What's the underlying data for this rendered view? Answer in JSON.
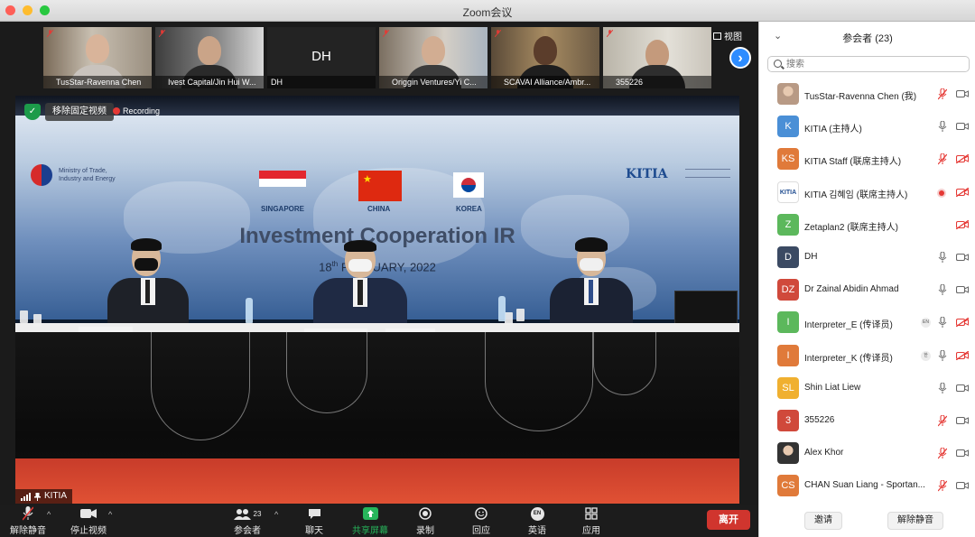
{
  "window": {
    "title": "Zoom会议"
  },
  "gallery": {
    "view_label": "视图",
    "tiles": [
      {
        "name": "TusStar-Ravenna Chen"
      },
      {
        "name": "Ivest Capital/Jin Hui W..."
      },
      {
        "name": "DH",
        "initials": "DH"
      },
      {
        "name": "Origgin Ventures/Yi C..."
      },
      {
        "name": "SCAVAI Alliance/Ambr..."
      },
      {
        "name": "355226"
      }
    ]
  },
  "main_video": {
    "unpin_label": "移除固定视频",
    "recording_label": "Recording",
    "speaker_name": "KITIA",
    "slide": {
      "ministry": "Ministry of Trade,\nIndustry and Energy",
      "flags": [
        "SINGAPORE",
        "CHINA",
        "KOREA"
      ],
      "kitia_logo": "KITIA",
      "headline": "Investment Cooperation IR",
      "date_prefix": "18",
      "date_sup": "th",
      "date_rest": " FEBRUARY, 2022"
    }
  },
  "toolbar": {
    "unmute": "解除静音",
    "stop_video": "停止视频",
    "participants": "参会者",
    "participants_count": "23",
    "chat": "聊天",
    "share": "共享屏幕",
    "record": "录制",
    "reactions": "回应",
    "language": "英语",
    "language_badge": "EN",
    "apps": "应用",
    "leave": "离开"
  },
  "panel": {
    "title": "参会者 (23)",
    "search_placeholder": "搜索",
    "invite": "邀请",
    "unmute": "解除静音",
    "participants": [
      {
        "name": "TusStar-Ravenna Chen (我)",
        "avatar": "",
        "color": "#b89a85",
        "photo": true,
        "mic": "muted",
        "cam": "on"
      },
      {
        "name": "KITIA (主持人)",
        "avatar": "K",
        "color": "#4a8fd6",
        "mic": "on",
        "cam": "on"
      },
      {
        "name": "KITIA Staff (联席主持人)",
        "avatar": "KS",
        "color": "#e07a3a",
        "mic": "muted",
        "cam": "off"
      },
      {
        "name": "KITIA 김혜임 (联席主持人)",
        "avatar": "",
        "color": "#1e4b8f",
        "logo": true,
        "mic": "recording",
        "cam": "off-muted"
      },
      {
        "name": "Zetaplan2 (联席主持人)",
        "avatar": "Z",
        "color": "#5cb85c",
        "mic": "none",
        "cam": "off"
      },
      {
        "name": "DH",
        "avatar": "D",
        "color": "#3b4a63",
        "mic": "on",
        "cam": "on"
      },
      {
        "name": "Dr Zainal Abidin Ahmad",
        "avatar": "DZ",
        "color": "#d0493b",
        "mic": "on",
        "cam": "on"
      },
      {
        "name": "Interpreter_E (传译员)",
        "avatar": "I",
        "color": "#5cb85c",
        "badge": "EN",
        "mic": "on",
        "cam": "off"
      },
      {
        "name": "Interpreter_K (传译员)",
        "avatar": "I",
        "color": "#e07a3a",
        "badge": "한",
        "mic": "on",
        "cam": "off"
      },
      {
        "name": "Shin Liat Liew",
        "avatar": "SL",
        "color": "#f0b030",
        "mic": "on",
        "cam": "on"
      },
      {
        "name": "355226",
        "avatar": "3",
        "color": "#d0493b",
        "mic": "muted",
        "cam": "on"
      },
      {
        "name": "Alex Khor",
        "avatar": "",
        "color": "#333333",
        "photo": true,
        "mic": "muted",
        "cam": "on"
      },
      {
        "name": "CHAN Suan Liang - Sportan...",
        "avatar": "CS",
        "color": "#e07a3a",
        "mic": "muted",
        "cam": "on"
      }
    ]
  }
}
